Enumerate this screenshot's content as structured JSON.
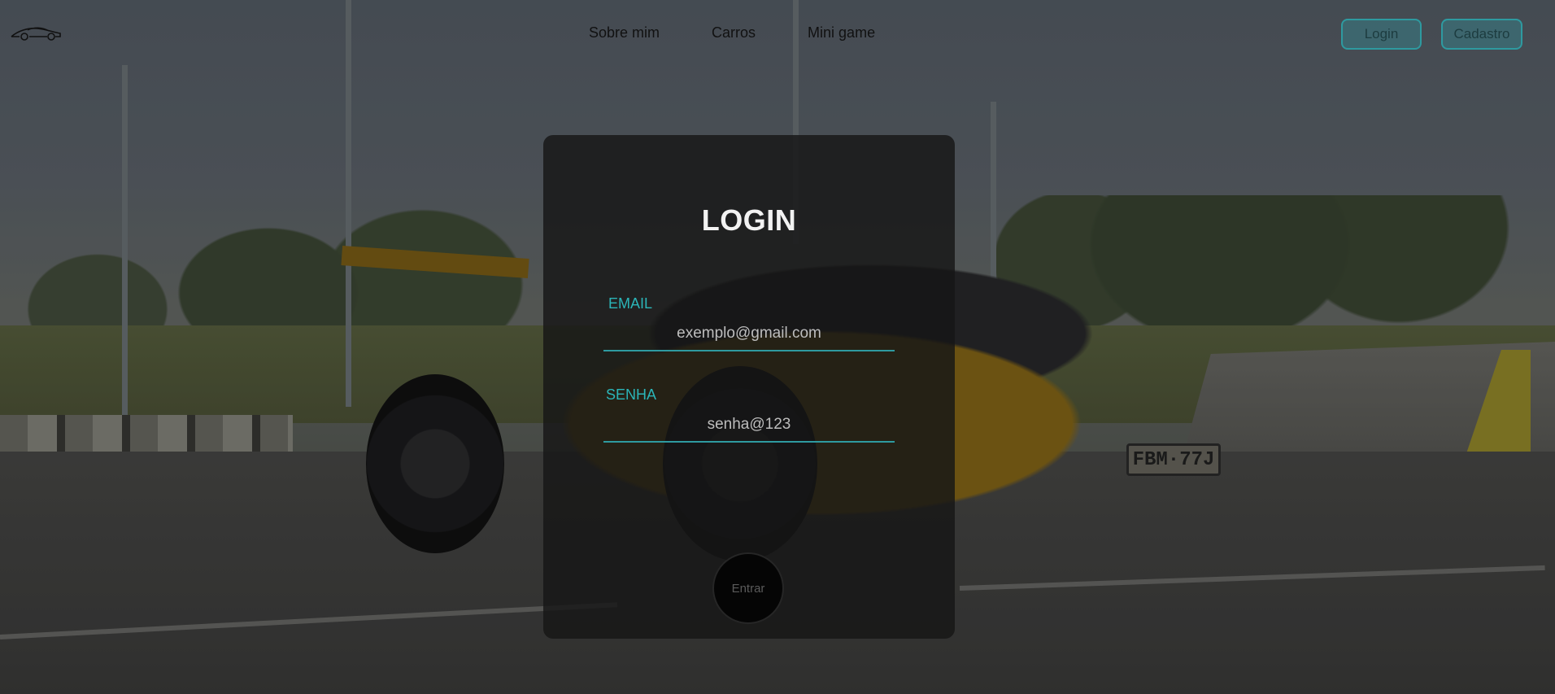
{
  "nav": {
    "logo_icon": "sports-car-logo-icon",
    "links": [
      {
        "label": "Sobre mim"
      },
      {
        "label": "Carros"
      },
      {
        "label": "Mini game"
      }
    ],
    "login_label": "Login",
    "cadastro_label": "Cadastro"
  },
  "login_form": {
    "title": "LOGIN",
    "email_label": "EMAIL",
    "email_placeholder": "exemplo@gmail.com",
    "password_label": "SENHA",
    "password_placeholder": "senha@123",
    "submit_label": "Entrar"
  },
  "background": {
    "license_plate": "FBM·77J"
  },
  "colors": {
    "accent": "#2bb5b8",
    "card_bg": "#161616",
    "button_border": "#2e9aa0"
  }
}
